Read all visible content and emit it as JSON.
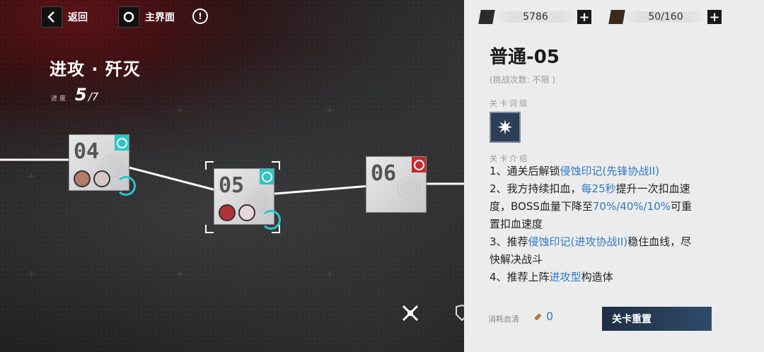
{
  "header": {
    "back_label": "返回",
    "home_label": "主界面",
    "info_glyph": "!"
  },
  "mode": {
    "title": "进攻 · 歼灭",
    "progress_label": "进度",
    "progress_current": "5",
    "progress_total": "/7"
  },
  "stages": [
    {
      "number": "04",
      "state": "cleared",
      "tag_color": "#2fc3c9"
    },
    {
      "number": "05",
      "state": "selected",
      "tag_color": "#2fc3c9"
    },
    {
      "number": "06",
      "state": "locked",
      "tag_color": "#c62a2a"
    }
  ],
  "resources": [
    {
      "icon": "gold-ticket-icon",
      "value": "5786"
    },
    {
      "icon": "stamina-vial-icon",
      "value": "50/160"
    }
  ],
  "panel": {
    "stage_name": "普通-05",
    "attempts": "(挑战次数: 不限 )",
    "affix_label": "关卡词缀",
    "intro_label": "关卡介绍",
    "desc": [
      {
        "text": "1、通关后解锁",
        "hl1": "侵蚀印记(先锋协战II)",
        "rest": ""
      },
      {
        "text": "2、我方持续扣血，",
        "hl1": "每25秒",
        "rest": "提升一次扣血速度，BOSS血量下降至"
      },
      {
        "text": "",
        "hl1": "70%/40%/10%",
        "rest": "可重置扣血速度"
      },
      {
        "text": "3、推荐",
        "hl1": "侵蚀印记(进攻协战II)",
        "rest": "稳住血线，尽快解决战斗"
      },
      {
        "text": "4、推荐上阵",
        "hl1": "进攻型",
        "rest": "构造体"
      }
    ]
  },
  "footer": {
    "serum_label": "消耗血清",
    "serum_value": "0",
    "reset_label": "关卡重置"
  },
  "colors": {
    "accent_blue": "#2b7ac6",
    "cyan": "#2fc3c9",
    "red": "#c62a2a"
  }
}
